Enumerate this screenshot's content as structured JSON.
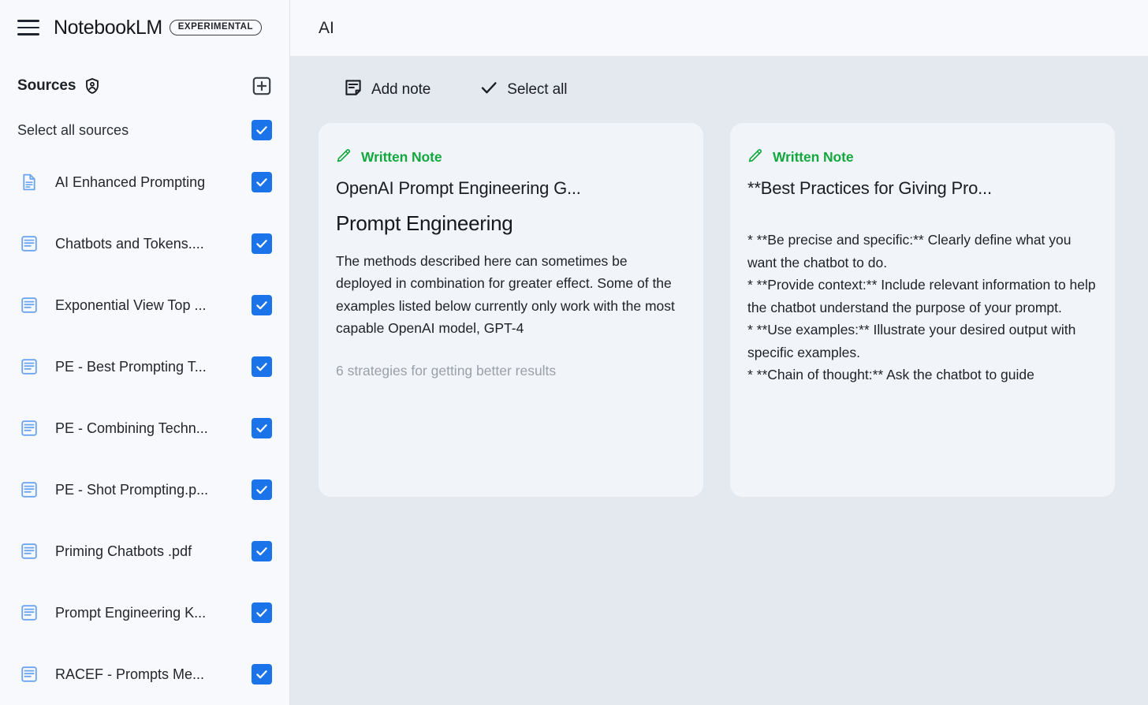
{
  "brand": {
    "name": "NotebookLM",
    "badge": "EXPERIMENTAL",
    "menu_icon": "hamburger-menu-icon"
  },
  "sidebar": {
    "sources_title": "Sources",
    "sources_shield_icon": "account-shield-icon",
    "add_source_icon": "add-box-icon",
    "select_all_sources_label": "Select all sources",
    "select_all_sources_checked": true,
    "items": [
      {
        "label": "AI Enhanced Prompting",
        "icon": "document-page-icon",
        "checked": true
      },
      {
        "label": "Chatbots and Tokens....",
        "icon": "article-lines-icon",
        "checked": true
      },
      {
        "label": "Exponential View Top ...",
        "icon": "article-lines-icon",
        "checked": true
      },
      {
        "label": "PE - Best Prompting T...",
        "icon": "article-lines-icon",
        "checked": true
      },
      {
        "label": "PE - Combining Techn...",
        "icon": "article-lines-icon",
        "checked": true
      },
      {
        "label": "PE - Shot Prompting.p...",
        "icon": "article-lines-icon",
        "checked": true
      },
      {
        "label": "Priming Chatbots .pdf",
        "icon": "article-lines-icon",
        "checked": true
      },
      {
        "label": "Prompt Engineering K...",
        "icon": "article-lines-icon",
        "checked": true
      },
      {
        "label": "RACEF - Prompts Me...",
        "icon": "article-lines-icon",
        "checked": true
      }
    ]
  },
  "topbar": {
    "title": "AI"
  },
  "toolbar": {
    "add_note_label": "Add note",
    "add_note_icon": "note-add-icon",
    "select_all_label": "Select all",
    "select_all_icon": "checkmark-icon"
  },
  "notes": [
    {
      "type_label": "Written Note",
      "type_icon": "pencil-icon",
      "title": "OpenAI Prompt Engineering G...",
      "heading": "Prompt Engineering",
      "body": "The methods described here can sometimes be deployed in combination for greater effect. Some of the examples listed below currently only work with the most capable OpenAI model, GPT-4",
      "faded_text": "6 strategies for getting better results"
    },
    {
      "type_label": "Written Note",
      "type_icon": "pencil-icon",
      "title": "**Best Practices for Giving Pro...",
      "heading": "",
      "body": "* **Be precise and specific:** Clearly define what you want the chatbot to do.\n* **Provide context:** Include relevant information to help the chatbot understand the purpose of your prompt.\n* **Use examples:** Illustrate your desired output with specific examples.\n* **Chain of thought:** Ask the chatbot to guide",
      "faded_text": ""
    }
  ],
  "colors": {
    "accent_blue": "#1a73e8",
    "note_green": "#12a83e",
    "sidebar_bg": "#f7f9fc",
    "content_bg": "#e4e8ef",
    "card_bg": "#f1f4f9",
    "source_icon_blue": "#6ba4f0"
  }
}
